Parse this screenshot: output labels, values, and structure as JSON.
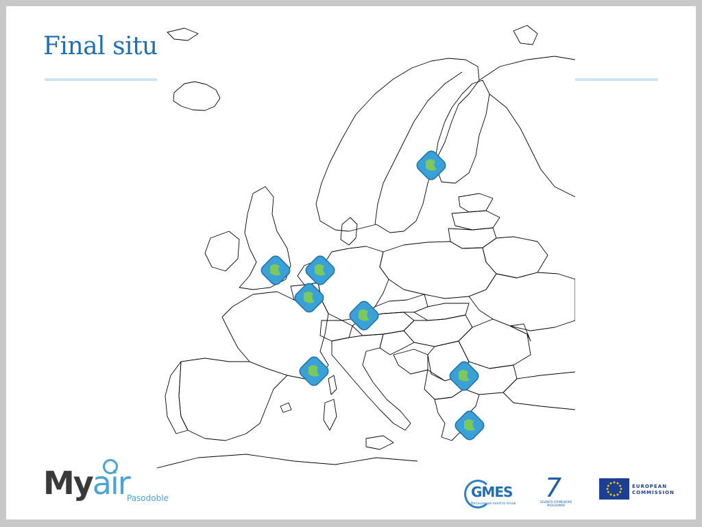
{
  "slide": {
    "title": "Final situ"
  },
  "map": {
    "region": "Europe",
    "marker_icon": "globe-icon",
    "marker_color": "#3aa0d8",
    "land_color": "#ffffff",
    "border_color": "#000000",
    "markers": [
      {
        "name": "marker-finland"
      },
      {
        "name": "marker-uk"
      },
      {
        "name": "marker-netherlands"
      },
      {
        "name": "marker-belgium"
      },
      {
        "name": "marker-germany"
      },
      {
        "name": "marker-southern-france"
      },
      {
        "name": "marker-bulgaria"
      },
      {
        "name": "marker-greece"
      }
    ]
  },
  "footer": {
    "myair_logo": {
      "my": "My",
      "air": "air",
      "sub": "Pasodoble"
    },
    "gmes_logo": {
      "text": "GMES",
      "tag": "Because we need to know"
    },
    "fp7_logo": {
      "num": "7",
      "label": "SEVENTH FRAMEWORK PROGRAMME"
    },
    "eu_logo": {
      "line1": "EUROPEAN",
      "line2": "COMMISSION"
    }
  }
}
